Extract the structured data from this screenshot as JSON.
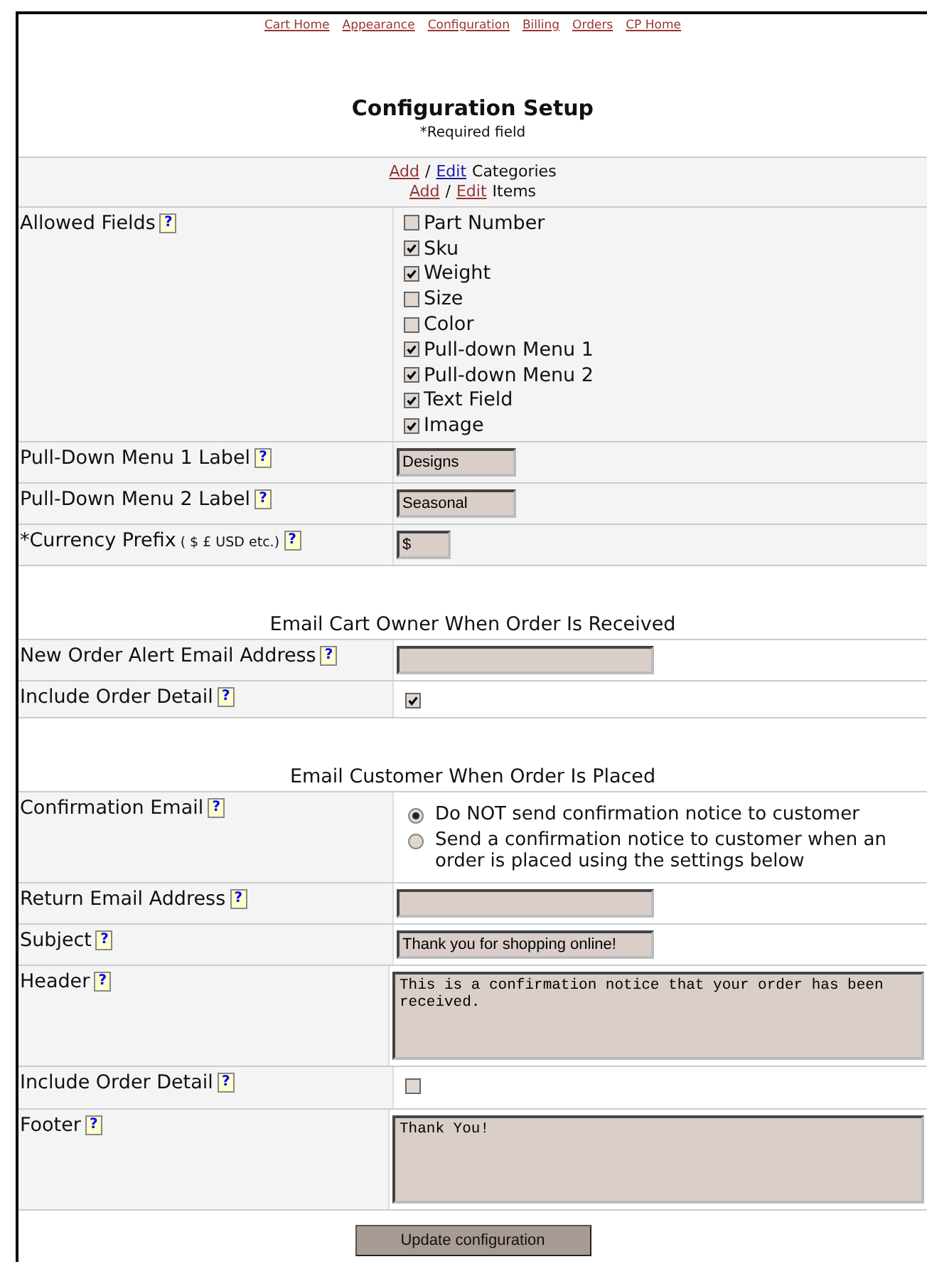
{
  "nav": [
    {
      "label": "Cart Home"
    },
    {
      "label": "Appearance"
    },
    {
      "label": "Configuration"
    },
    {
      "label": "Billing"
    },
    {
      "label": "Orders"
    },
    {
      "label": "CP Home"
    }
  ],
  "title": "Configuration Setup",
  "required_note": "*Required field",
  "manage_links": [
    {
      "add": {
        "label": "Add",
        "visited": true
      },
      "sep": "/",
      "edit": {
        "label": "Edit",
        "visited": false
      },
      "text": "Categories"
    },
    {
      "add": {
        "label": "Add",
        "visited": true
      },
      "sep": "/",
      "edit": {
        "label": "Edit",
        "visited": true
      },
      "text": "Items"
    }
  ],
  "sections": [
    {
      "rows": [
        {
          "kind": "checklist",
          "label": "Allowed Fields",
          "help": "?",
          "options": [
            {
              "label": "Part Number",
              "checked": false
            },
            {
              "label": "Sku",
              "checked": true
            },
            {
              "label": "Weight",
              "checked": true
            },
            {
              "label": "Size",
              "checked": false
            },
            {
              "label": "Color",
              "checked": false
            },
            {
              "label": "Pull-down Menu 1",
              "checked": true
            },
            {
              "label": "Pull-down Menu 2",
              "checked": true
            },
            {
              "label": "Text Field",
              "checked": true
            },
            {
              "label": "Image",
              "checked": true
            }
          ]
        },
        {
          "kind": "text",
          "label": "Pull-Down Menu 1 Label",
          "help": "?",
          "value": "Designs"
        },
        {
          "kind": "text",
          "label": "Pull-Down Menu 2 Label",
          "help": "?",
          "value": "Seasonal"
        },
        {
          "kind": "shorttext",
          "label": "*Currency Prefix",
          "note": "( $ £ USD etc.)",
          "help": "?",
          "value": "$"
        }
      ]
    },
    {
      "title": "Email Cart Owner When Order Is Received",
      "rows": [
        {
          "kind": "longtext",
          "label": "New Order Alert Email Address",
          "help": "?"
        },
        {
          "kind": "checkbox",
          "label": "Include Order Detail",
          "help": "?",
          "checked": true
        }
      ]
    },
    {
      "title": "Email Customer When Order Is Placed",
      "rows": [
        {
          "kind": "radio",
          "label": "Confirmation Email",
          "help": "?",
          "options": [
            {
              "label": "Do NOT send confirmation notice to customer",
              "selected": true
            },
            {
              "label": "Send a confirmation notice to customer when an order is placed using the settings below",
              "selected": false
            }
          ]
        },
        {
          "kind": "longtext",
          "label": "Return Email Address",
          "help": "?"
        },
        {
          "kind": "longtext",
          "label": "Subject",
          "help": "?",
          "value": "Thank you for shopping online!"
        },
        {
          "kind": "textarea",
          "label": "Header",
          "help": "?",
          "value": "This is a confirmation notice that your order has been received."
        },
        {
          "kind": "checkbox",
          "label": "Include Order Detail",
          "help": "?",
          "checked": false
        },
        {
          "kind": "textarea",
          "label": "Footer",
          "help": "?",
          "value": "Thank You!"
        }
      ]
    }
  ],
  "submit": "Update configuration"
}
